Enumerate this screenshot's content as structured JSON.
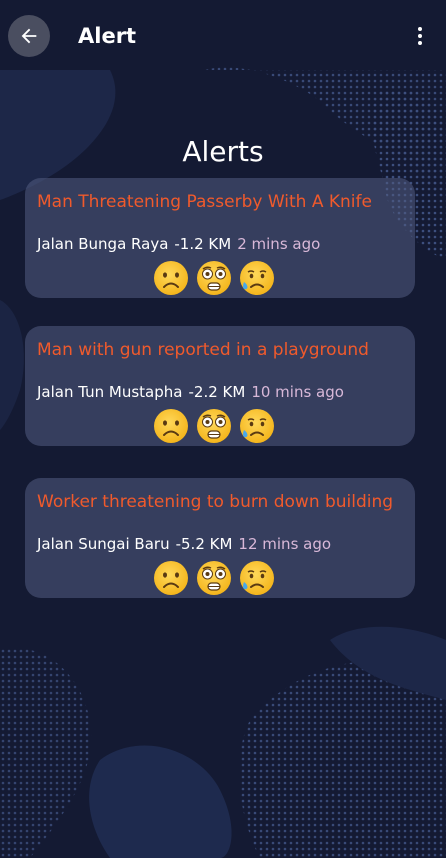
{
  "appbar": {
    "title": "Alert",
    "back_icon": "arrow-left-icon",
    "menu_icon": "more-vert-icon"
  },
  "heading": "Alerts",
  "colors": {
    "background": "#141a33",
    "card": "#525c82",
    "alert_title": "#f05a2c",
    "time": "#d8b8d8"
  },
  "alerts": [
    {
      "title": "Man Threatening Passerby With A Knife",
      "location": "Jalan Bunga Raya",
      "distance": "-1.2 KM",
      "time": "2 mins ago",
      "reactions": [
        "frowning-face-icon",
        "flushed-face-icon",
        "sad-sweat-face-icon"
      ]
    },
    {
      "title": "Man with gun reported in a playground",
      "location": "Jalan Tun Mustapha",
      "distance": "-2.2 KM",
      "time": "10 mins ago",
      "reactions": [
        "frowning-face-icon",
        "flushed-face-icon",
        "sad-sweat-face-icon"
      ]
    },
    {
      "title": "Worker threatening to burn down building",
      "location": "Jalan Sungai Baru",
      "distance": "-5.2 KM",
      "time": "12 mins ago",
      "reactions": [
        "frowning-face-icon",
        "flushed-face-icon",
        "sad-sweat-face-icon"
      ]
    }
  ]
}
